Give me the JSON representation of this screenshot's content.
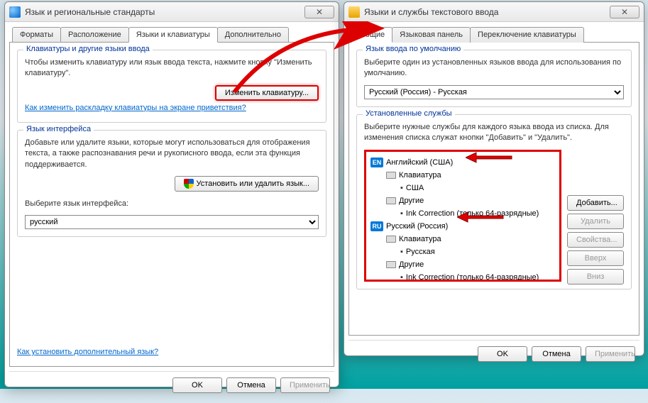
{
  "left_window": {
    "title": "Язык и региональные стандарты",
    "tabs": [
      "Форматы",
      "Расположение",
      "Языки и клавиатуры",
      "Дополнительно"
    ],
    "active_tab": 2,
    "group1": {
      "title": "Клавиатуры и другие языки ввода",
      "desc": "Чтобы изменить клавиатуру или язык ввода текста, нажмите кнопку \"Изменить клавиатуру\".",
      "button": "Изменить клавиатуру...",
      "link": "Как изменить раскладку клавиатуры на экране приветствия?"
    },
    "group2": {
      "title": "Язык интерфейса",
      "desc": "Добавьте или удалите языки, которые могут использоваться для отображения текста, а также распознавания речи и рукописного ввода, если эта функция поддерживается.",
      "button": "Установить или удалить язык...",
      "select_label": "Выберите язык интерфейса:",
      "select_value": "русский"
    },
    "bottom_link": "Как установить дополнительный язык?",
    "buttons": {
      "ok": "OK",
      "cancel": "Отмена",
      "apply": "Применить"
    }
  },
  "right_window": {
    "title": "Языки и службы текстового ввода",
    "tabs": [
      "Общие",
      "Языковая панель",
      "Переключение клавиатуры"
    ],
    "active_tab": 0,
    "group1": {
      "title": "Язык ввода по умолчанию",
      "desc": "Выберите один из установленных языков ввода для использования по умолчанию.",
      "select_value": "Русский (Россия) - Русская"
    },
    "group2": {
      "title": "Установленные службы",
      "desc": "Выберите нужные службы для каждого языка ввода из списка. Для изменения списка служат кнопки \"Добавить\" и \"Удалить\".",
      "tree": [
        {
          "badge": "EN",
          "label": "Английский (США)"
        },
        {
          "indent": 1,
          "kbd": true,
          "label": "Клавиатура"
        },
        {
          "indent": 2,
          "label": "США"
        },
        {
          "indent": 1,
          "kbd": true,
          "label": "Другие"
        },
        {
          "indent": 2,
          "label": "Ink Correction (только 64-разрядные)"
        },
        {
          "badge": "RU",
          "label": "Русский (Россия)"
        },
        {
          "indent": 1,
          "kbd": true,
          "label": "Клавиатура"
        },
        {
          "indent": 2,
          "label": "Русская"
        },
        {
          "indent": 1,
          "kbd": true,
          "label": "Другие"
        },
        {
          "indent": 2,
          "label": "Ink Correction (только 64-разрядные)"
        }
      ],
      "side_buttons": {
        "add": "Добавить...",
        "remove": "Удалить",
        "props": "Свойства...",
        "up": "Вверх",
        "down": "Вниз"
      }
    },
    "buttons": {
      "ok": "OK",
      "cancel": "Отмена",
      "apply": "Применить"
    }
  }
}
